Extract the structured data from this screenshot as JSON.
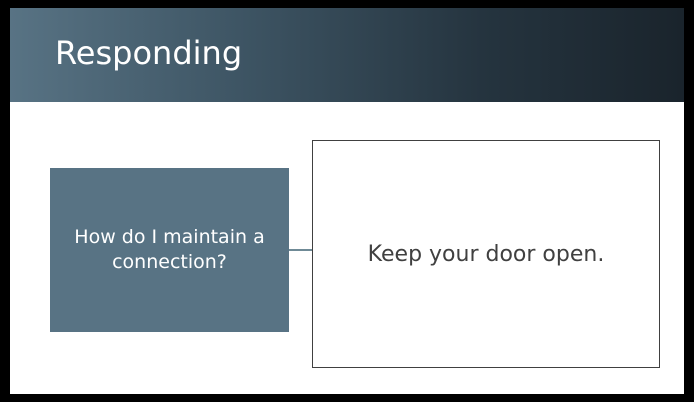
{
  "slide": {
    "title": "Responding",
    "question": "How do I maintain a connection?",
    "answer": "Keep your door open."
  },
  "colors": {
    "title_bar_start": "#587384",
    "title_bar_end": "#1a242c",
    "question_box": "#587384",
    "answer_border": "#404040",
    "answer_text": "#404040",
    "frame": "#000000"
  }
}
